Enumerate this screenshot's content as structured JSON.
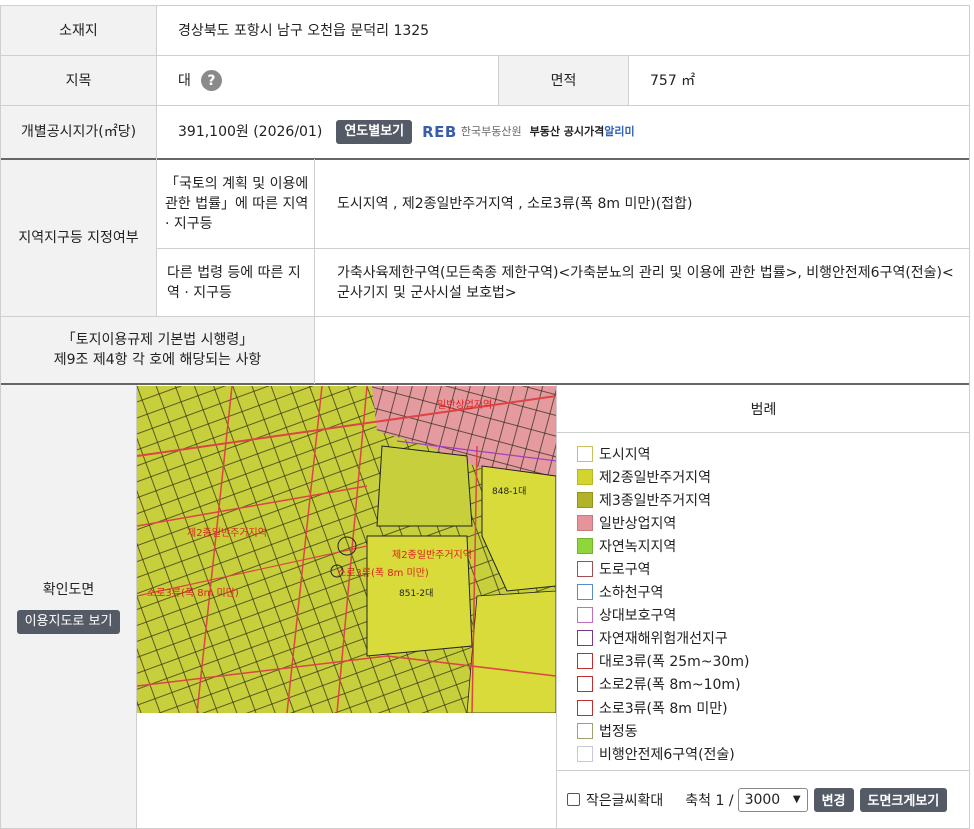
{
  "location": {
    "label": "소재지",
    "value": "경상북도 포항시 남구 오천읍 문덕리 1325"
  },
  "land_category": {
    "label": "지목",
    "value": "대",
    "help_icon": "question-circle-icon",
    "help_text": "?"
  },
  "area": {
    "label": "면적",
    "value": "757 ㎡"
  },
  "official_price": {
    "label": "개별공시지가(㎡당)",
    "value": "391,100원 (2026/01)",
    "button": "연도별보기",
    "reb_logo": "REB",
    "reb_name": "한국부동산원",
    "reb_service": "부동산 공시가격",
    "reb_service2": "알리미"
  },
  "zoning": {
    "label": "지역지구등 지정여부",
    "national_label": "「국토의 계획 및 이용에 관한 법률」에 따른 지역 · 지구등",
    "national_value": "도시지역 , 제2종일반주거지역 , 소로3류(폭 8m 미만)(접합)",
    "other_label": "다른 법령 등에 따른 지역 · 지구등",
    "other_value": "가축사육제한구역(모든축종 제한구역)<가축분뇨의 관리 및 이용에 관한 법률>, 비행안전제6구역(전술)<군사기지 및 군사시설 보호법>"
  },
  "enforcement": {
    "label_line1": "「토지이용규제 기본법 시행령」",
    "label_line2": "제9조 제4항 각 호에 해당되는 사항",
    "value": ""
  },
  "map_section": {
    "label": "확인도면",
    "button": "이용지도로 보기",
    "map_labels": {
      "lot1": "848-1대",
      "lot2": "851-2대",
      "zone1": "제2종일반주거지역",
      "zone2": "소로3류(폭 8m 미만)",
      "zone3": "일반상업지역"
    }
  },
  "legend": {
    "title": "범례",
    "items": [
      {
        "label": "도시지역",
        "color": "#ffffff",
        "border": "#c9c15a"
      },
      {
        "label": "제2종일반주거지역",
        "color": "#d4d42e",
        "border": "#b8b820"
      },
      {
        "label": "제3종일반주거지역",
        "color": "#b3b32a",
        "border": "#95951e"
      },
      {
        "label": "일반상업지역",
        "color": "#e6949a",
        "border": "#c77a80"
      },
      {
        "label": "자연녹지지역",
        "color": "#8fd63a",
        "border": "#6fb42a"
      },
      {
        "label": "도로구역",
        "color": "#ffffff",
        "border": "#a05050"
      },
      {
        "label": "소하천구역",
        "color": "#ffffff",
        "border": "#5a8ad0"
      },
      {
        "label": "상대보호구역",
        "color": "#ffffff",
        "border": "#c070c0"
      },
      {
        "label": "자연재해위험개선지구",
        "color": "#ffffff",
        "border": "#7a3a8a"
      },
      {
        "label": "대로3류(폭 25m~30m)",
        "color": "#ffffff",
        "border": "#c03030"
      },
      {
        "label": "소로2류(폭 8m~10m)",
        "color": "#ffffff",
        "border": "#c03030"
      },
      {
        "label": "소로3류(폭 8m 미만)",
        "color": "#ffffff",
        "border": "#c03030"
      },
      {
        "label": "법정동",
        "color": "#ffffff",
        "border": "#a0a070"
      },
      {
        "label": "비행안전제6구역(전술)",
        "color": "#ffffff",
        "border": "#c8c8d8"
      }
    ]
  },
  "controls": {
    "small_text_zoom": "작은글씨확대",
    "scale_label": "축척 1 /",
    "scale_value": "3000",
    "change_button": "변경",
    "large_map_button": "도면크게보기",
    "dropdown_icon": "chevron-down-icon"
  }
}
